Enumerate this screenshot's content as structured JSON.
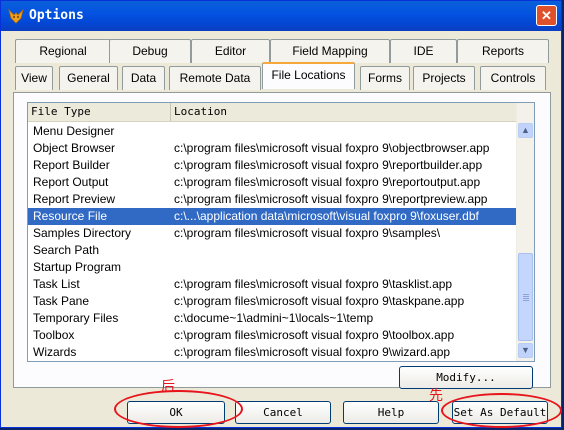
{
  "window": {
    "title": "Options",
    "close_glyph": "✕"
  },
  "tabs_row1": [
    "Regional",
    "Debug",
    "Editor",
    "Field Mapping",
    "IDE",
    "Reports"
  ],
  "tabs_row2": [
    "View",
    "General",
    "Data",
    "Remote Data",
    "File Locations",
    "Forms",
    "Projects",
    "Controls"
  ],
  "active_tab": "File Locations",
  "list": {
    "headers": [
      "File Type",
      "Location"
    ],
    "rows": [
      {
        "type": "Menu Designer",
        "location": ""
      },
      {
        "type": "Object Browser",
        "location": "c:\\program files\\microsoft visual foxpro 9\\objectbrowser.app"
      },
      {
        "type": "Report Builder",
        "location": "c:\\program files\\microsoft visual foxpro 9\\reportbuilder.app"
      },
      {
        "type": "Report Output",
        "location": "c:\\program files\\microsoft visual foxpro 9\\reportoutput.app"
      },
      {
        "type": "Report Preview",
        "location": "c:\\program files\\microsoft visual foxpro 9\\reportpreview.app"
      },
      {
        "type": "Resource File",
        "location": "c:\\...\\application data\\microsoft\\visual foxpro 9\\foxuser.dbf",
        "selected": true
      },
      {
        "type": "Samples Directory",
        "location": "c:\\program files\\microsoft visual foxpro 9\\samples\\"
      },
      {
        "type": "Search Path",
        "location": ""
      },
      {
        "type": "Startup Program",
        "location": ""
      },
      {
        "type": "Task List",
        "location": "c:\\program files\\microsoft visual foxpro 9\\tasklist.app"
      },
      {
        "type": "Task Pane",
        "location": "c:\\program files\\microsoft visual foxpro 9\\taskpane.app"
      },
      {
        "type": "Temporary Files",
        "location": "c:\\docume~1\\admini~1\\locals~1\\temp"
      },
      {
        "type": "Toolbox",
        "location": "c:\\program files\\microsoft visual foxpro 9\\toolbox.app"
      },
      {
        "type": "Wizards",
        "location": "c:\\program files\\microsoft visual foxpro 9\\wizard.app"
      }
    ]
  },
  "buttons": {
    "modify": "Modify...",
    "ok": "OK",
    "cancel": "Cancel",
    "help": "Help",
    "set_default": "Set As Default"
  },
  "annotations": {
    "after": "后",
    "first": "先"
  },
  "colors": {
    "annotation": "#e8141c",
    "selection": "#316ac5",
    "active_tab_accent": "#f7a83a"
  }
}
